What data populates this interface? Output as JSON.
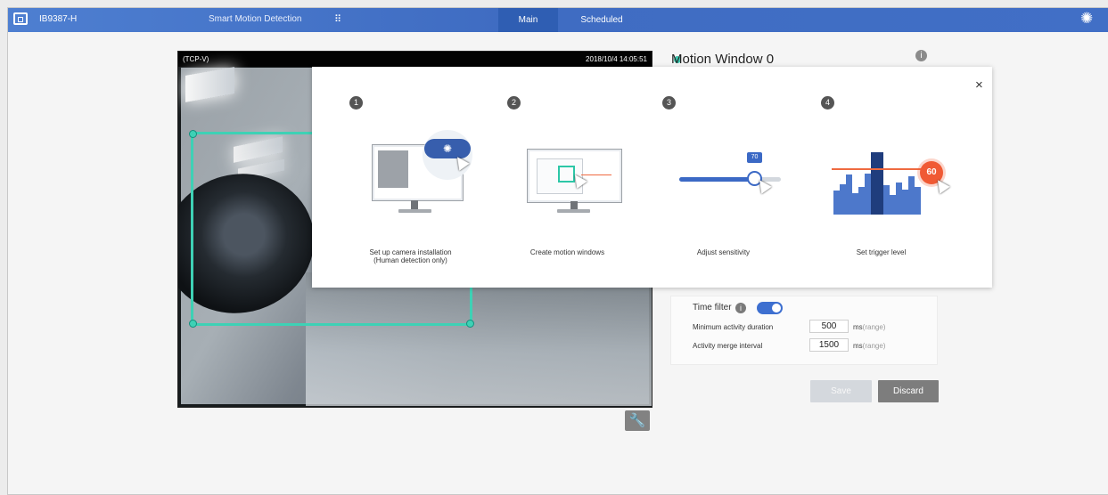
{
  "topbar": {
    "device_name": "IB9387-H",
    "feature_name": "Smart Motion Detection",
    "grid_icon": "grid-icon",
    "tabs": [
      {
        "label": "Main",
        "active": true
      },
      {
        "label": "Scheduled",
        "active": false
      }
    ],
    "settings_icon": "gear-icon",
    "accent": "#3f6cc2"
  },
  "video": {
    "stream": "(TCP-V)",
    "timestamp": "2018/10/4 14:05:51",
    "motion_color": "#3ed1b5"
  },
  "motion_window": {
    "title": "Motion Window 0",
    "status_color": "#39c2aa",
    "info_icon": "i"
  },
  "tutorial": {
    "close_label": "×",
    "steps": [
      {
        "number": "1",
        "text": "Set up camera installation\n(Human detection only)"
      },
      {
        "number": "2",
        "text": "Create motion windows"
      },
      {
        "number": "3",
        "text": "Adjust sensitivity"
      },
      {
        "number": "4",
        "text": "Set trigger level"
      }
    ],
    "sensitivity_badge": "70",
    "trigger_badge": "60"
  },
  "time_filter": {
    "label": "Time filter",
    "enabled": true,
    "info_icon": "i",
    "rows": [
      {
        "label": "Minimum activity duration",
        "value": "500",
        "unit": "ms",
        "range": "(range)"
      },
      {
        "label": "Activity merge interval",
        "value": "1500",
        "unit": "ms",
        "range": "(range)"
      }
    ]
  },
  "actions": {
    "save_label": "Save",
    "discard_label": "Discard"
  }
}
